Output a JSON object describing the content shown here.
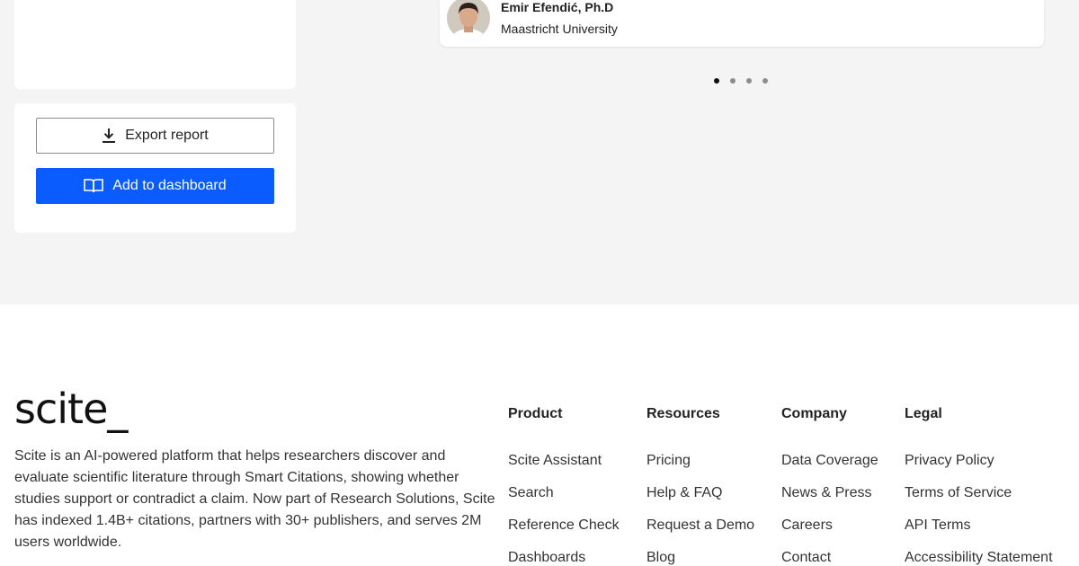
{
  "testimonial": {
    "name": "Emir Efendić, Ph.D",
    "org": "Maastricht University"
  },
  "carousel": {
    "dot_count": 4,
    "active_index": 0
  },
  "actions": {
    "export_label": "Export report",
    "dashboard_label": "Add to dashboard"
  },
  "colors": {
    "accent": "#0b5cff",
    "page_bg": "#f4f4f4"
  },
  "footer": {
    "logo": "scite_",
    "description": "Scite is an AI-powered platform that helps researchers discover and evaluate scientific literature through Smart Citations, showing whether studies support or contradict a claim. Now part of Research Solutions, Scite has indexed 1.4B+ citations, partners with 30+ publishers, and serves 2M users worldwide.",
    "columns": [
      {
        "title": "Product",
        "links": [
          "Scite Assistant",
          "Search",
          "Reference Check",
          "Dashboards"
        ]
      },
      {
        "title": "Resources",
        "links": [
          "Pricing",
          "Help & FAQ",
          "Request a Demo",
          "Blog"
        ]
      },
      {
        "title": "Company",
        "links": [
          "Data Coverage",
          "News & Press",
          "Careers",
          "Contact"
        ]
      },
      {
        "title": "Legal",
        "links": [
          "Privacy Policy",
          "Terms of Service",
          "API Terms",
          "Accessibility Statement"
        ]
      }
    ]
  }
}
